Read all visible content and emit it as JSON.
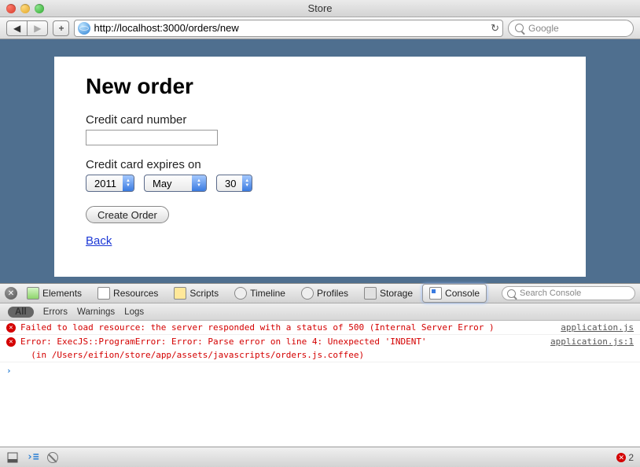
{
  "window": {
    "title": "Store"
  },
  "toolbar": {
    "url": "http://localhost:3000/orders/new",
    "add_label": "+",
    "search_placeholder": "Google"
  },
  "page": {
    "heading": "New order",
    "cc_number_label": "Credit card number",
    "cc_number_value": "",
    "cc_expires_label": "Credit card expires on",
    "year": "2011",
    "month": "May",
    "day": "30",
    "submit_label": "Create Order",
    "back_link": "Back"
  },
  "devtools": {
    "tabs": {
      "elements": "Elements",
      "resources": "Resources",
      "scripts": "Scripts",
      "timeline": "Timeline",
      "profiles": "Profiles",
      "storage": "Storage",
      "console": "Console"
    },
    "search_placeholder": "Search Console",
    "filters": {
      "all": "All",
      "errors": "Errors",
      "warnings": "Warnings",
      "logs": "Logs"
    },
    "logs": [
      {
        "msg": "Failed to load resource: the server responded with a status of 500 (Internal Server Error )",
        "src": "application.js"
      },
      {
        "msg": "Error: ExecJS::ProgramError: Error: Parse error on line 4: Unexpected 'INDENT'",
        "sub": "  (in /Users/eifion/store/app/assets/javascripts/orders.js.coffee)",
        "src": "application.js:1"
      }
    ],
    "error_count": "2"
  }
}
